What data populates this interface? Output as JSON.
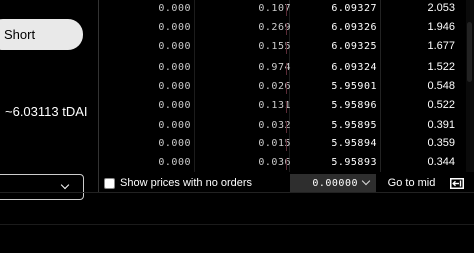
{
  "order_form": {
    "side_button": "Short",
    "price_estimate": "~6.03113 tDAI"
  },
  "orderbook": {
    "rows": [
      {
        "c1": "0.000",
        "c2": "0.107",
        "price": "6.09327",
        "total": "2.053"
      },
      {
        "c1": "0.000",
        "c2": "0.269",
        "price": "6.09326",
        "total": "1.946"
      },
      {
        "c1": "0.000",
        "c2": "0.155",
        "price": "6.09325",
        "total": "1.677"
      },
      {
        "c1": "0.000",
        "c2": "0.974",
        "price": "6.09324",
        "total": "1.522"
      },
      {
        "c1": "0.000",
        "c2": "0.026",
        "price": "5.95901",
        "total": "0.548"
      },
      {
        "c1": "0.000",
        "c2": "0.131",
        "price": "5.95896",
        "total": "0.522"
      },
      {
        "c1": "0.000",
        "c2": "0.032",
        "price": "5.95895",
        "total": "0.391"
      },
      {
        "c1": "0.000",
        "c2": "0.015",
        "price": "5.95894",
        "total": "0.359"
      },
      {
        "c1": "0.000",
        "c2": "0.036",
        "price": "5.95893",
        "total": "0.344"
      }
    ]
  },
  "footer": {
    "show_prices_label": "Show prices with no orders",
    "tick_size": "0.00000",
    "go_to_mid_label": "Go to mid"
  },
  "icons": {
    "collapse": "panel-collapse-icon",
    "chevron": "chevron-down-icon"
  }
}
